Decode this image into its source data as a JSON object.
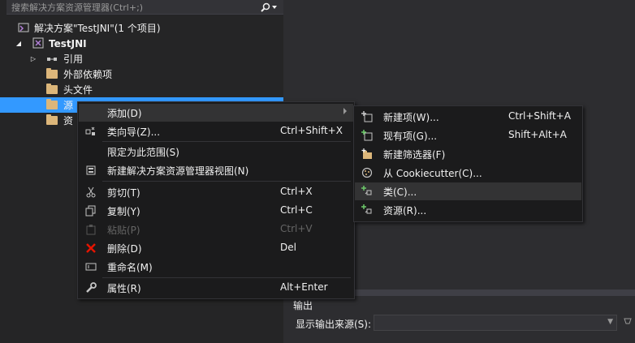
{
  "search": {
    "placeholder": "搜索解决方案资源管理器(Ctrl+;)"
  },
  "tree": {
    "solution": "解决方案\"TestJNI\"(1 个项目)",
    "project": "TestJNI",
    "references": "引用",
    "external_deps": "外部依赖项",
    "header_files": "头文件",
    "source_files_partial": "源",
    "resource_files_partial": "资"
  },
  "context_menu": {
    "add": "添加(D)",
    "class_wizard": {
      "label": "类向导(Z)...",
      "shortcut": "Ctrl+Shift+X"
    },
    "scope_to_this": "限定为此范围(S)",
    "new_explorer_view": "新建解决方案资源管理器视图(N)",
    "cut": {
      "label": "剪切(T)",
      "shortcut": "Ctrl+X"
    },
    "copy": {
      "label": "复制(Y)",
      "shortcut": "Ctrl+C"
    },
    "paste": {
      "label": "粘贴(P)",
      "shortcut": "Ctrl+V"
    },
    "delete": {
      "label": "删除(D)",
      "shortcut": "Del"
    },
    "rename": {
      "label": "重命名(M)"
    },
    "properties": {
      "label": "属性(R)",
      "shortcut": "Alt+Enter"
    }
  },
  "submenu": {
    "new_item": {
      "label": "新建项(W)...",
      "shortcut": "Ctrl+Shift+A"
    },
    "existing_item": {
      "label": "现有项(G)...",
      "shortcut": "Shift+Alt+A"
    },
    "new_filter": {
      "label": "新建筛选器(F)"
    },
    "from_cookiecutter": {
      "label": "从 Cookiecutter(C)..."
    },
    "class": {
      "label": "类(C)..."
    },
    "resource": {
      "label": "资源(R)..."
    }
  },
  "output": {
    "title": "输出",
    "source_label": "显示输出来源(S):"
  },
  "colors": {
    "selection": "#3399ff",
    "menu_bg": "#1b1b1c",
    "panel_bg": "#252526",
    "delete_red": "#e51400",
    "add_green": "#6dc96a"
  }
}
